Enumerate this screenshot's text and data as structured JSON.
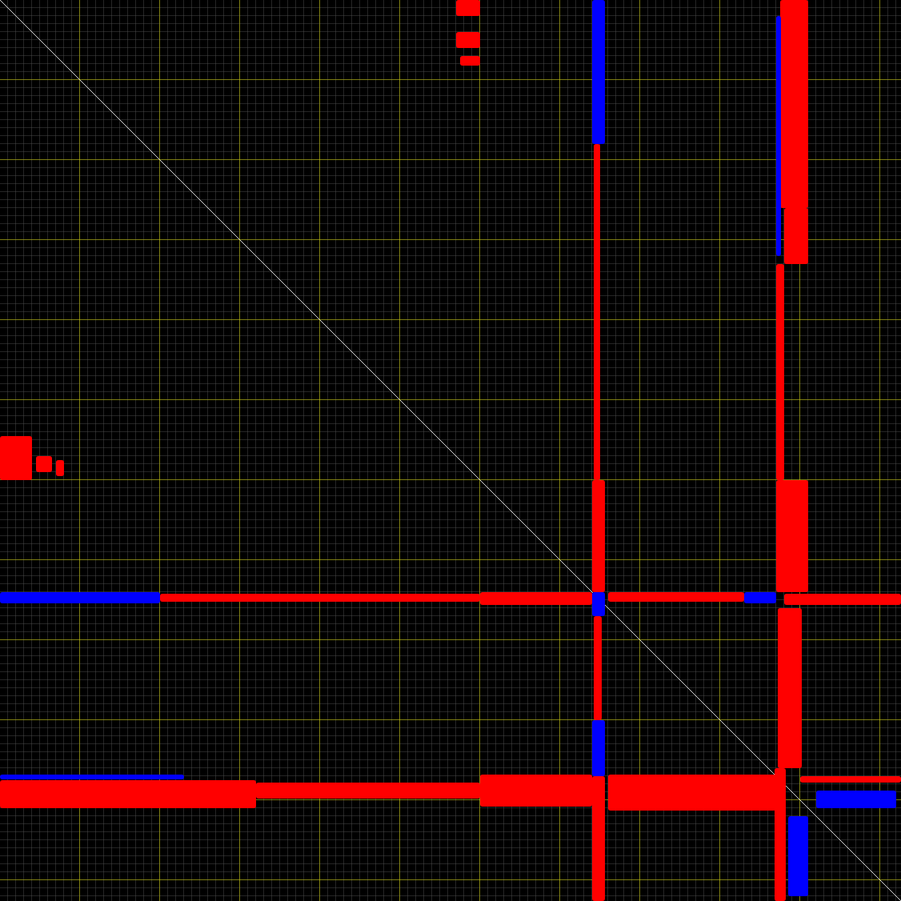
{
  "plot": {
    "kind": "dotplot"
  }
}
